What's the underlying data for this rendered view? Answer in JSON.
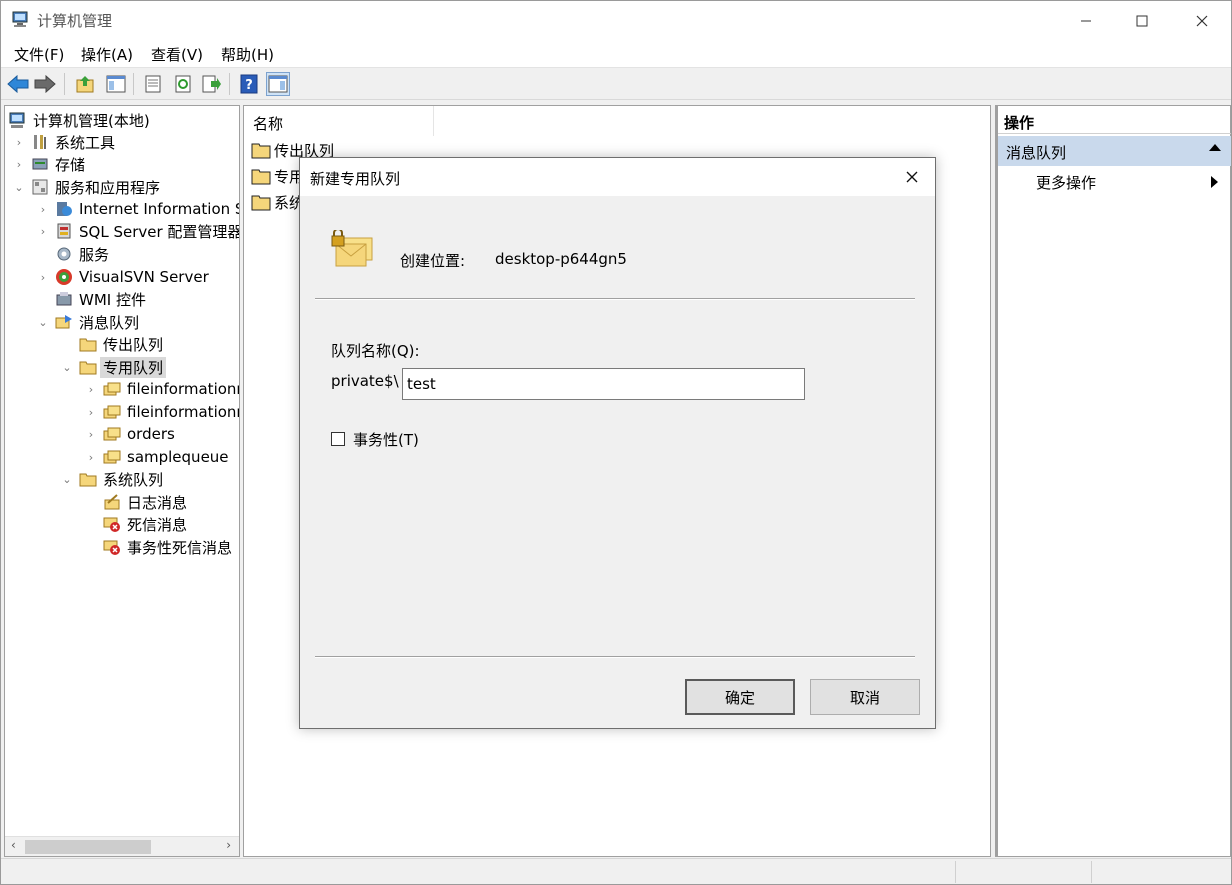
{
  "window": {
    "title": "计算机管理",
    "minimize_icon": "minimize-icon",
    "maximize_icon": "maximize-icon",
    "close_icon": "close-icon"
  },
  "menu": [
    "文件(F)",
    "操作(A)",
    "查看(V)",
    "帮助(H)"
  ],
  "toolbar": [
    "back-arrow-icon",
    "forward-arrow-icon",
    "up-folder-icon",
    "show-hide-console-tree-icon",
    "properties-icon",
    "refresh-icon",
    "export-list-icon",
    "help-icon",
    "show-hide-action-pane-icon"
  ],
  "tree": {
    "root": "计算机管理(本地)",
    "system_tools": "系统工具",
    "storage": "存储",
    "services_apps": "服务和应用程序",
    "iis": "Internet Information Se",
    "sql": "SQL Server 配置管理器",
    "services": "服务",
    "visualsvn": "VisualSVN Server",
    "wmi": "WMI 控件",
    "msmq": "消息队列",
    "outgoing": "传出队列",
    "private": "专用队列",
    "q1": "fileinformationn",
    "q2": "fileinformationn",
    "q3": "orders",
    "q4": "samplequeue",
    "system": "系统队列",
    "journal": "日志消息",
    "deadletter": "死信消息",
    "tx_deadletter": "事务性死信消息"
  },
  "list": {
    "column_name": "名称",
    "rows": [
      "传出队列",
      "专用",
      "系统"
    ]
  },
  "actions": {
    "header": "操作",
    "section": "消息队列",
    "more": "更多操作"
  },
  "dialog": {
    "title": "新建专用队列",
    "location_label": "创建位置:",
    "location_value": "desktop-p644gn5",
    "queue_name_label": "队列名称(Q):",
    "prefix": "private$\\",
    "queue_name_value": "test",
    "transactional_label": "事务性(T)",
    "transactional_checked": false,
    "ok": "确定",
    "cancel": "取消"
  },
  "colors": {
    "selection_highlight": "#d9d9d9",
    "action_section_bg": "#c9d9ec",
    "folder_yellow": "#f5d67b"
  }
}
